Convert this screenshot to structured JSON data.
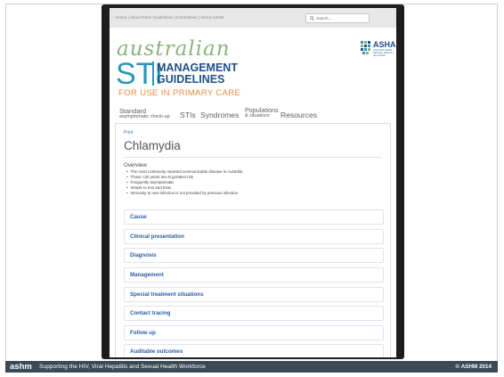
{
  "site": {
    "top_links": "Home | About these Guidelines | Committees | About ASHM",
    "search_placeholder": "search...",
    "logo_script": "australian",
    "logo_sti": "STI",
    "logo_management": "MANAGEMENT",
    "logo_guidelines": "GUIDELINES",
    "logo_subtitle": "FOR USE IN PRIMARY CARE",
    "partner_logo_title": "ASHA",
    "partner_logo_small": "AUSTRALASIAN SEXUAL HEALTH ALLIANCE",
    "nav": [
      {
        "line1": "Standard",
        "line2": "asymptomatic check-up"
      },
      {
        "label": "STIs"
      },
      {
        "label": "Syndromes"
      },
      {
        "line1": "Populations",
        "line2": "& situations"
      },
      {
        "label": "Resources"
      }
    ]
  },
  "page": {
    "print_label": "Print",
    "title": "Chlamydia",
    "overview_heading": "Overview",
    "overview_items": [
      "The most commonly reported communicable disease in Australia",
      "Those <30 years are at greatest risk",
      "Frequently asymptomatic",
      "Simple to test and treat",
      "Immunity to new infection is not provided by previous infection"
    ],
    "sections": [
      "Cause",
      "Clinical presentation",
      "Diagnosis",
      "Management",
      "Special treatment situations",
      "Contact tracing",
      "Follow up",
      "Auditable outcomes"
    ]
  },
  "footer": {
    "brand": "ashm",
    "tagline": "Supporting the HIV, Viral Hepatitis and Sexual Health Workforce",
    "copyright": "© ASHM 2014"
  },
  "colors": {
    "footer_bg": "#3b4a54",
    "section_link": "#2a5ba8",
    "logo_script_green": "#8ab37b",
    "logo_blue": "#2e95b9",
    "subtitle_orange": "#e58e3e"
  },
  "icons": [
    "search-icon",
    "asha-emblem-icon"
  ]
}
